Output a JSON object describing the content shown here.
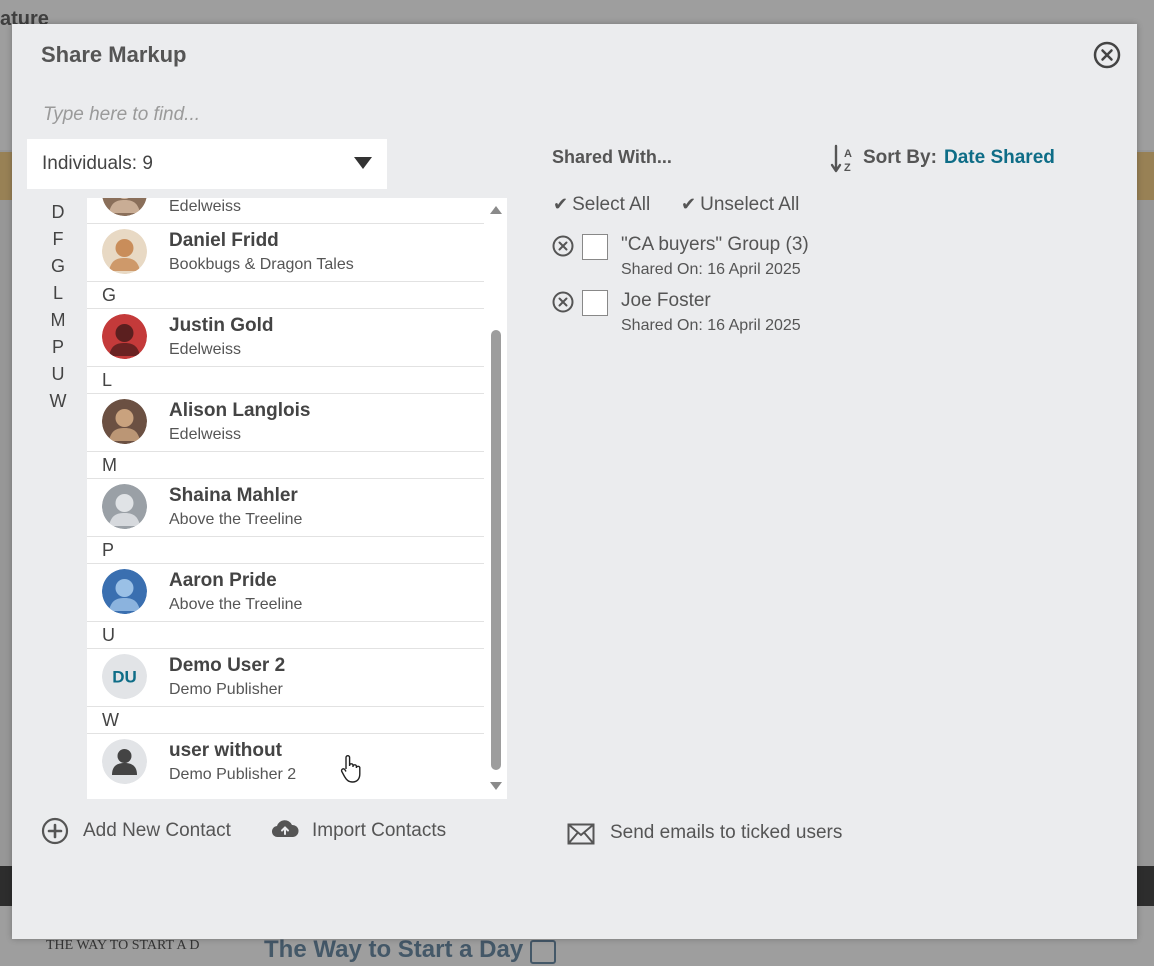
{
  "modal": {
    "title": "Share Markup",
    "close_icon": "close-circle-icon"
  },
  "search": {
    "placeholder": "Type here to find..."
  },
  "filter": {
    "label": "Individuals: 9"
  },
  "alpha_index": [
    "D",
    "F",
    "G",
    "L",
    "M",
    "P",
    "U",
    "W"
  ],
  "contacts": [
    {
      "type": "contact",
      "name": "",
      "org": "Edelweiss",
      "avatar": "photo"
    },
    {
      "type": "contact",
      "name": "Daniel Fridd",
      "org": "Bookbugs & Dragon Tales",
      "avatar": "photo"
    },
    {
      "type": "letter",
      "letter": "G"
    },
    {
      "type": "contact",
      "name": "Justin Gold",
      "org": "Edelweiss",
      "avatar": "photo"
    },
    {
      "type": "letter",
      "letter": "L"
    },
    {
      "type": "contact",
      "name": "Alison Langlois",
      "org": "Edelweiss",
      "avatar": "photo"
    },
    {
      "type": "letter",
      "letter": "M"
    },
    {
      "type": "contact",
      "name": "Shaina Mahler",
      "org": "Above the Treeline",
      "avatar": "photo"
    },
    {
      "type": "letter",
      "letter": "P"
    },
    {
      "type": "contact",
      "name": "Aaron Pride",
      "org": "Above the Treeline",
      "avatar": "photo"
    },
    {
      "type": "letter",
      "letter": "U"
    },
    {
      "type": "contact",
      "name": "Demo User 2",
      "org": "Demo Publisher",
      "avatar": "initials",
      "initials": "DU"
    },
    {
      "type": "letter",
      "letter": "W"
    },
    {
      "type": "contact",
      "name": "user without",
      "org": "Demo Publisher 2",
      "avatar": "silhouette"
    }
  ],
  "actions": {
    "add_contact": "Add New Contact",
    "import_contacts": "Import Contacts",
    "send_emails": "Send emails to ticked users"
  },
  "shared_with": {
    "heading": "Shared With...",
    "sort_label": "Sort By:",
    "sort_value": "Date Shared",
    "select_all": "Select All",
    "unselect_all": "Unselect All",
    "items": [
      {
        "name": "\"CA buyers\" Group (3)",
        "date": "Shared On: 16 April 2025"
      },
      {
        "name": "Joe Foster",
        "date": "Shared On: 16 April 2025"
      }
    ]
  },
  "background": {
    "top_left_text": "ature",
    "book_title": "The Way to Start a Day",
    "book_thumb_text": "THE WAY TO START A D"
  },
  "colors": {
    "accent": "#0e6d87",
    "modal_bg": "#ebecee",
    "text": "#555555"
  }
}
